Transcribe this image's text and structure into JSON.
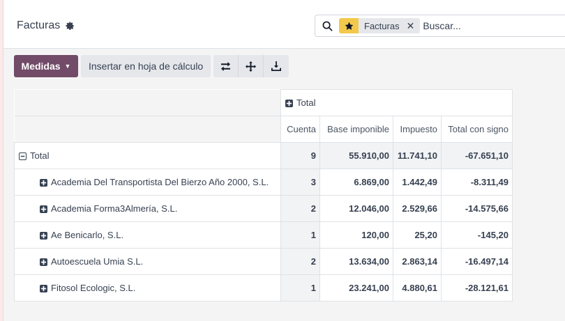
{
  "page": {
    "title": "Facturas"
  },
  "search": {
    "facet_label": "Facturas",
    "placeholder": "Buscar..."
  },
  "toolbar": {
    "measures_label": "Medidas",
    "insert_label": "Insertar en hoja de cálculo",
    "icons": [
      "flip-axis-icon",
      "expand-all-icon",
      "download-icon"
    ]
  },
  "pivot": {
    "col_header": "Total",
    "measures": [
      "Cuenta",
      "Base imponible",
      "Impuesto",
      "Total con signo"
    ],
    "total_row": {
      "label": "Total",
      "cuenta": "9",
      "base": "55.910,00",
      "impuesto": "11.741,10",
      "total": "-67.651,10"
    },
    "rows": [
      {
        "label": "Academia Del Transportista Del Bierzo Año 2000, S.L.",
        "cuenta": "3",
        "base": "6.869,00",
        "impuesto": "1.442,49",
        "total": "-8.311,49"
      },
      {
        "label": "Academia Forma3Almería, S.L.",
        "cuenta": "2",
        "base": "12.046,00",
        "impuesto": "2.529,66",
        "total": "-14.575,66"
      },
      {
        "label": "Ae Benicarlo, S.L.",
        "cuenta": "1",
        "base": "120,00",
        "impuesto": "25,20",
        "total": "-145,20"
      },
      {
        "label": "Autoescuela Umia S.L.",
        "cuenta": "2",
        "base": "13.634,00",
        "impuesto": "2.863,14",
        "total": "-16.497,14"
      },
      {
        "label": "Fitosol Ecologic, S.L.",
        "cuenta": "1",
        "base": "23.241,00",
        "impuesto": "4.880,61",
        "total": "-28.121,61"
      }
    ]
  },
  "colors": {
    "primary": "#714b67",
    "favorite_star": "#f2c94c",
    "secondary_button": "#e5e7eb"
  }
}
